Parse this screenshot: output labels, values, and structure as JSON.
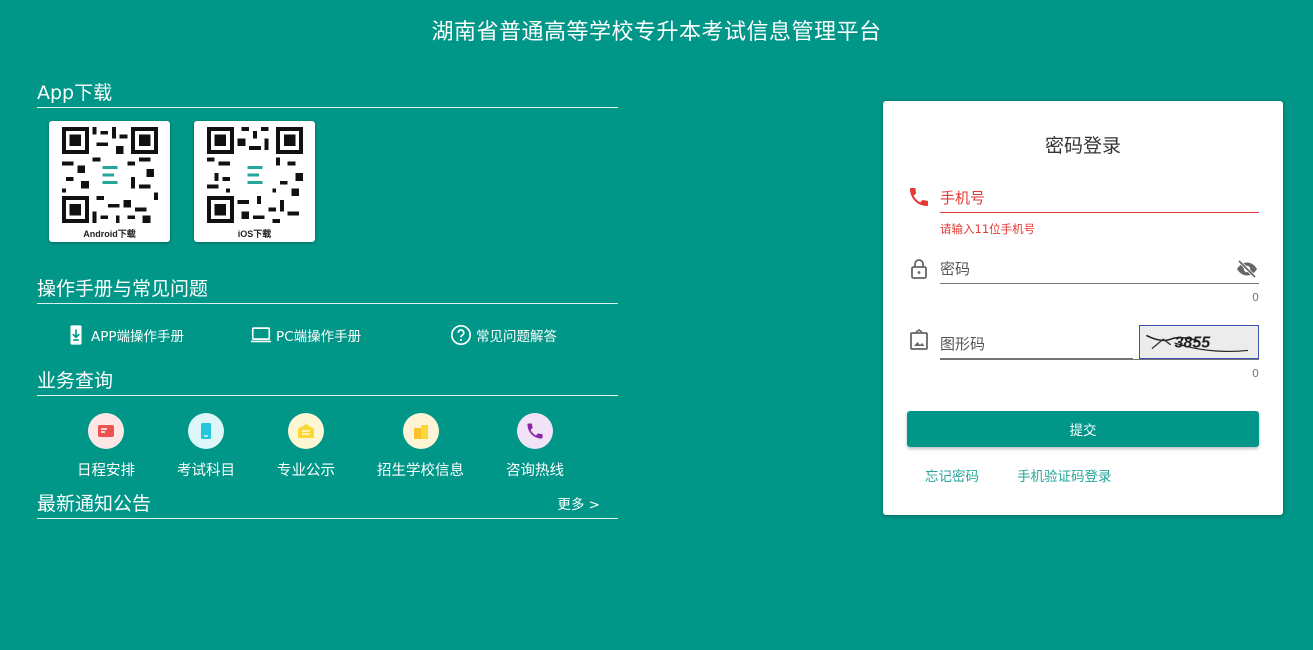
{
  "page": {
    "title": "湖南省普通高等学校专升本考试信息管理平台"
  },
  "app_download": {
    "heading": "App下载",
    "items": [
      {
        "caption": "Android下载"
      },
      {
        "caption": "iOS下载"
      }
    ]
  },
  "manuals": {
    "heading": "操作手册与常见问题",
    "items": [
      {
        "label": "APP端操作手册",
        "icon": "phone-download-icon"
      },
      {
        "label": "PC端操作手册",
        "icon": "laptop-icon"
      },
      {
        "label": "常见问题解答",
        "icon": "question-circle-icon"
      }
    ]
  },
  "services": {
    "heading": "业务查询",
    "items": [
      {
        "label": "日程安排",
        "icon": "schedule-icon",
        "color": "#ef5350",
        "bg": "#fde7e6"
      },
      {
        "label": "考试科目",
        "icon": "exam-subject-icon",
        "color": "#26c6da",
        "bg": "#ddf7f8"
      },
      {
        "label": "专业公示",
        "icon": "notice-icon",
        "color": "#fdd835",
        "bg": "#fff7d4"
      },
      {
        "label": "招生学校信息",
        "icon": "school-icon",
        "color": "#fbc02d",
        "bg": "#fff5d6"
      },
      {
        "label": "咨询热线",
        "icon": "phone-icon",
        "color": "#8e24aa",
        "bg": "#f1e3f5"
      }
    ]
  },
  "news": {
    "heading": "最新通知公告",
    "more": "更多 >"
  },
  "login": {
    "title": "密码登录",
    "phone": {
      "placeholder": "手机号",
      "error": "请输入11位手机号"
    },
    "password": {
      "placeholder": "密码",
      "counter": "0"
    },
    "captcha": {
      "placeholder": "图形码",
      "counter": "0",
      "image_text": "3855"
    },
    "submit": "提交",
    "forgot": "忘记密码",
    "sms_login": "手机验证码登录"
  },
  "colors": {
    "brand": "#009688",
    "error": "#e53935",
    "link": "#26a69a"
  }
}
